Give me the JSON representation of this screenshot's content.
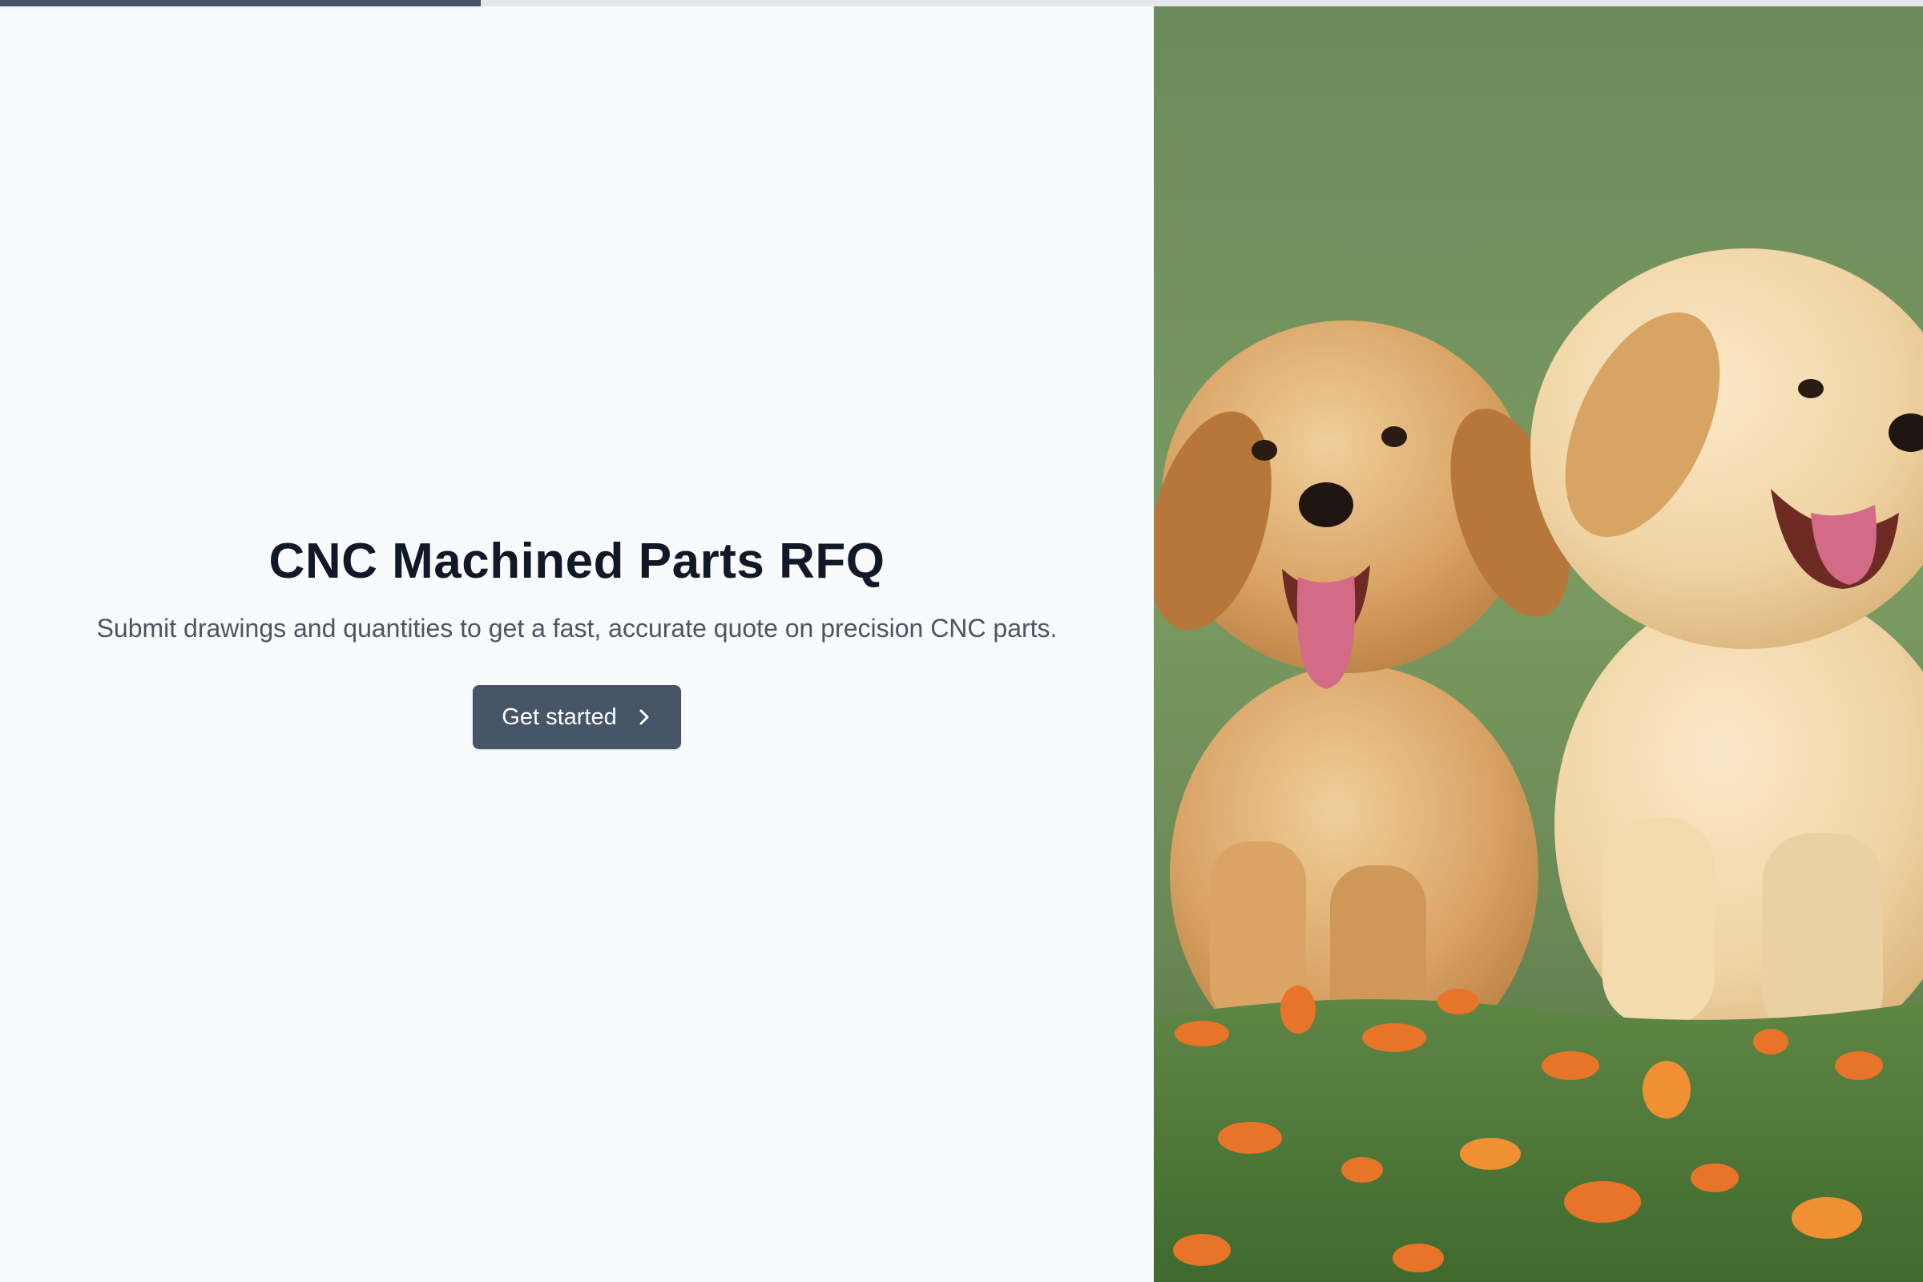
{
  "progress": {
    "value": 0.25,
    "track_color": "#e5e7eb",
    "fill_color": "#475569"
  },
  "hero": {
    "title": "CNC Machined Parts RFQ",
    "subtitle": "Submit drawings and quantities to get a fast, accurate quote on precision CNC parts.",
    "cta_label": "Get started",
    "cta_icon": "chevron-right-icon"
  },
  "image": {
    "subject": "two-golden-retriever-puppies-on-grass"
  },
  "colors": {
    "accent": "#475569",
    "background": "#f9fafb",
    "title": "#111827",
    "subtitle": "#4b5563"
  }
}
